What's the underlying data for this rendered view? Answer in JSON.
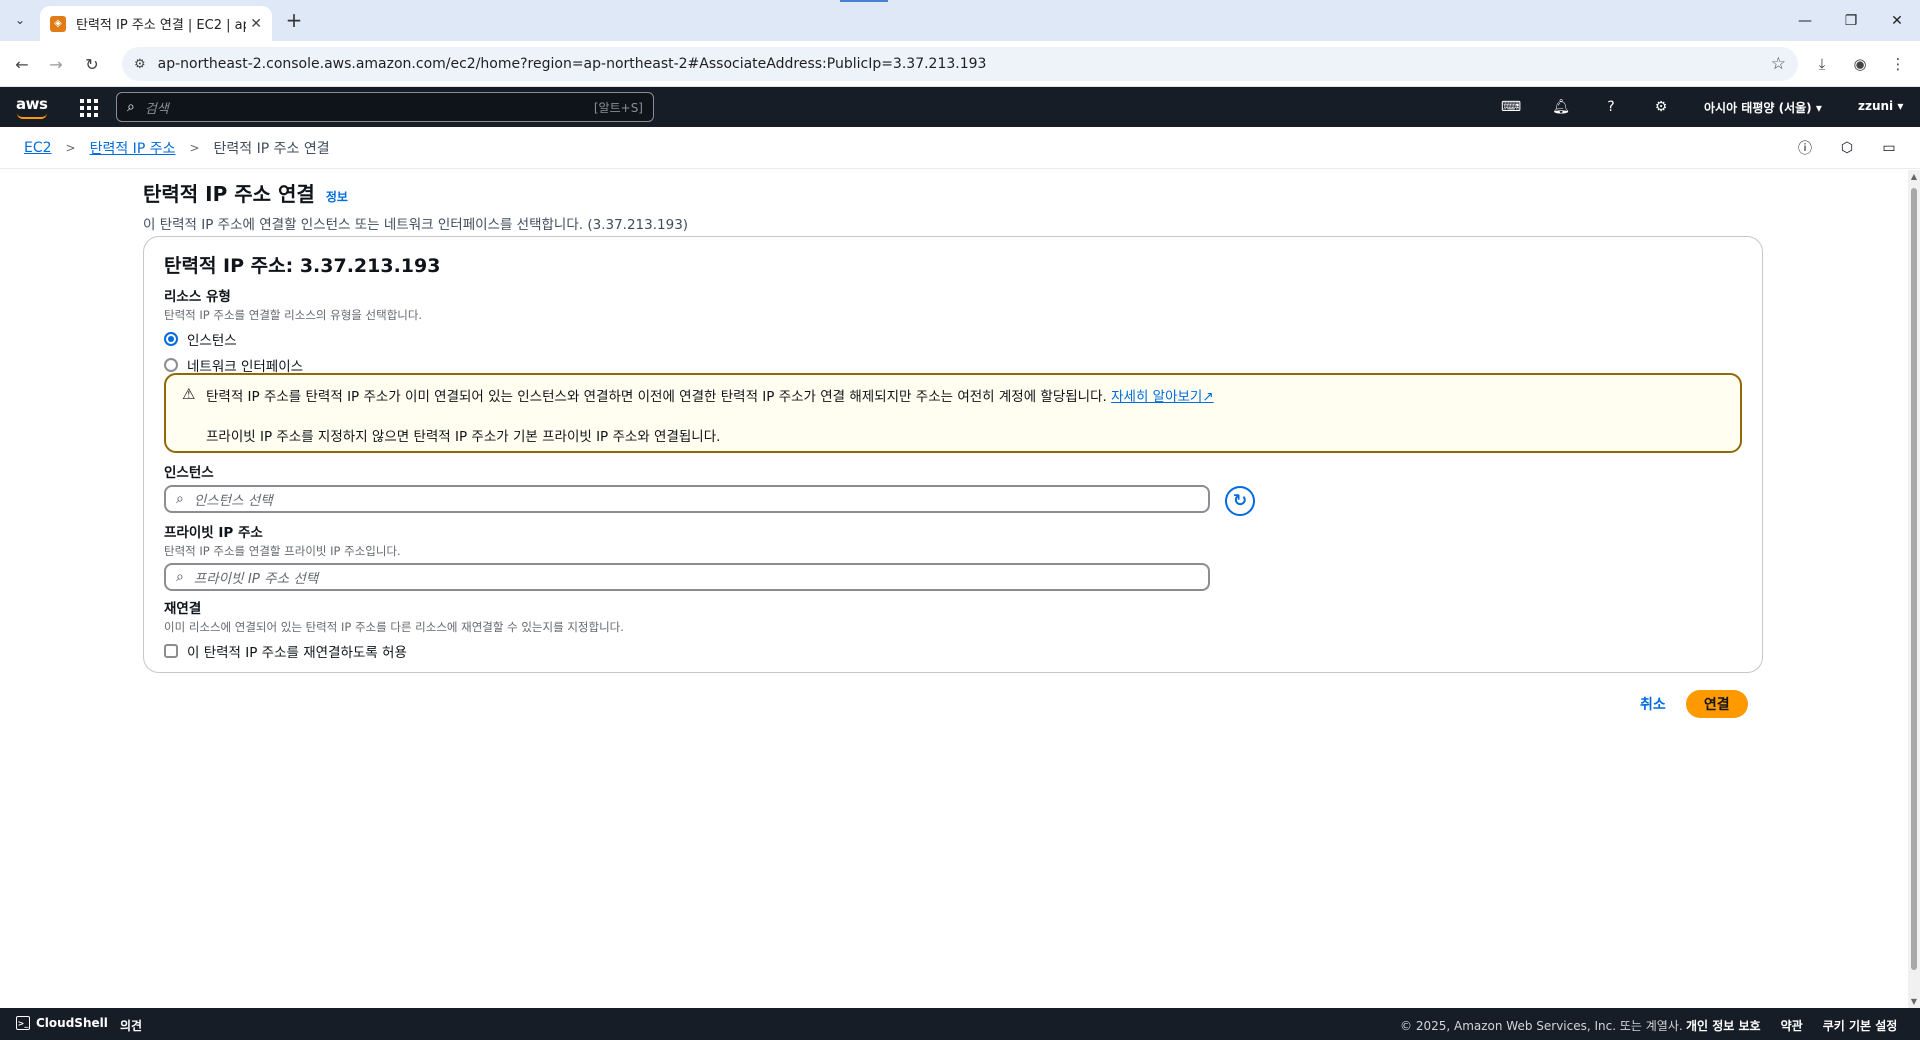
{
  "browser": {
    "tab_title": "탄력적 IP 주소 연결 | EC2 | ap",
    "tab_close": "✕",
    "new_tab": "+",
    "url": "ap-northeast-2.console.aws.amazon.com/ec2/home?region=ap-northeast-2#AssociateAddress:PublicIp=3.37.213.193",
    "icons": [
      "back-icon",
      "forward-icon",
      "reload-icon",
      "site-info-icon",
      "bookmark-star-icon",
      "download-icon",
      "profile-icon",
      "menu-kebab-icon"
    ]
  },
  "aws_nav": {
    "logo": "aws",
    "search_placeholder": "검색",
    "search_shortcut": "[알트+S]",
    "region": "아시아 태평양 (서울) ▾",
    "user": "zzuni ▾"
  },
  "breadcrumb": {
    "items": [
      "EC2",
      "탄력적 IP 주소"
    ],
    "current": "탄력적 IP 주소 연결"
  },
  "page": {
    "title": "탄력적 IP 주소 연결",
    "info": "정보",
    "description": "이 탄력적 IP 주소에 연결할 인스턴스 또는 네트워크 인터페이스를 선택합니다. (3.37.213.193)"
  },
  "card": {
    "title": "탄력적 IP 주소: 3.37.213.193",
    "resource_type": {
      "label": "리소스 유형",
      "description": "탄력적 IP 주소를 연결할 리소스의 유형을 선택합니다.",
      "options": [
        "인스턴스",
        "네트워크 인터페이스"
      ],
      "selected": "인스턴스"
    },
    "alert": {
      "line1": "탄력적 IP 주소를 탄력적 IP 주소가 이미 연결되어 있는 인스턴스와 연결하면 이전에 연결한 탄력적 IP 주소가 연결 해제되지만 주소는 여전히 계정에 할당됩니다.",
      "link": "자세히 알아보기",
      "line2": "프라이빗 IP 주소를 지정하지 않으면 탄력적 IP 주소가 기본 프라이빗 IP 주소와 연결됩니다."
    },
    "instance": {
      "label": "인스턴스",
      "placeholder": "인스턴스 선택"
    },
    "private_ip": {
      "label": "프라이빗 IP 주소",
      "description": "탄력적 IP 주소를 연결할 프라이빗 IP 주소입니다.",
      "placeholder": "프라이빗 IP 주소 선택"
    },
    "reassociation": {
      "label": "재연결",
      "description": "이미 리소스에 연결되어 있는 탄력적 IP 주소를 다른 리소스에 재연결할 수 있는지를 지정합니다.",
      "checkbox_label": "이 탄력적 IP 주소를 재연결하도록 허용",
      "checked": false
    }
  },
  "actions": {
    "cancel": "취소",
    "associate": "연결"
  },
  "footer": {
    "cloudshell": "CloudShell",
    "feedback": "의견",
    "copyright": "© 2025, Amazon Web Services, Inc. 또는 계열사.",
    "links": [
      "개인 정보 보호",
      "약관",
      "쿠키 기본 설정"
    ]
  },
  "colors": {
    "link": "#006ce0",
    "primary_button": "#ff9900",
    "alert_border": "#906806",
    "nav_bg": "#161d26"
  }
}
